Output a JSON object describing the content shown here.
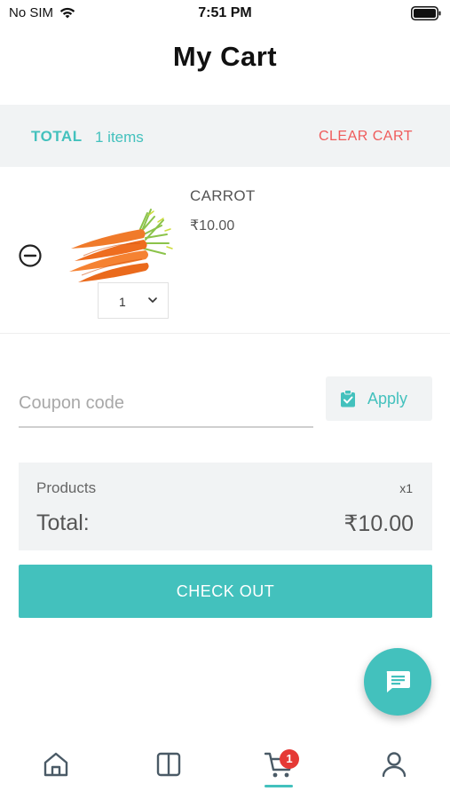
{
  "status_bar": {
    "carrier": "No SIM",
    "time": "7:51 PM"
  },
  "header": {
    "title": "My Cart"
  },
  "total_bar": {
    "label": "TOTAL",
    "items_count": "1 items",
    "clear_label": "CLEAR CART"
  },
  "cart_items": [
    {
      "name": "CARROT",
      "price": "₹10.00",
      "quantity": "1",
      "image_icon": "carrot-bunch-image"
    }
  ],
  "coupon": {
    "placeholder": "Coupon code",
    "value": "",
    "apply_label": "Apply"
  },
  "summary": {
    "products_label": "Products",
    "products_count": "x1",
    "total_label": "Total:",
    "total_amount": "₹10.00"
  },
  "checkout": {
    "label": "CHECK OUT"
  },
  "bottom_nav": {
    "cart_badge": "1",
    "active": "cart"
  },
  "colors": {
    "accent": "#43c1bd",
    "danger": "#ef5b5b",
    "panel_bg": "#f1f3f4",
    "badge": "#e53935"
  }
}
